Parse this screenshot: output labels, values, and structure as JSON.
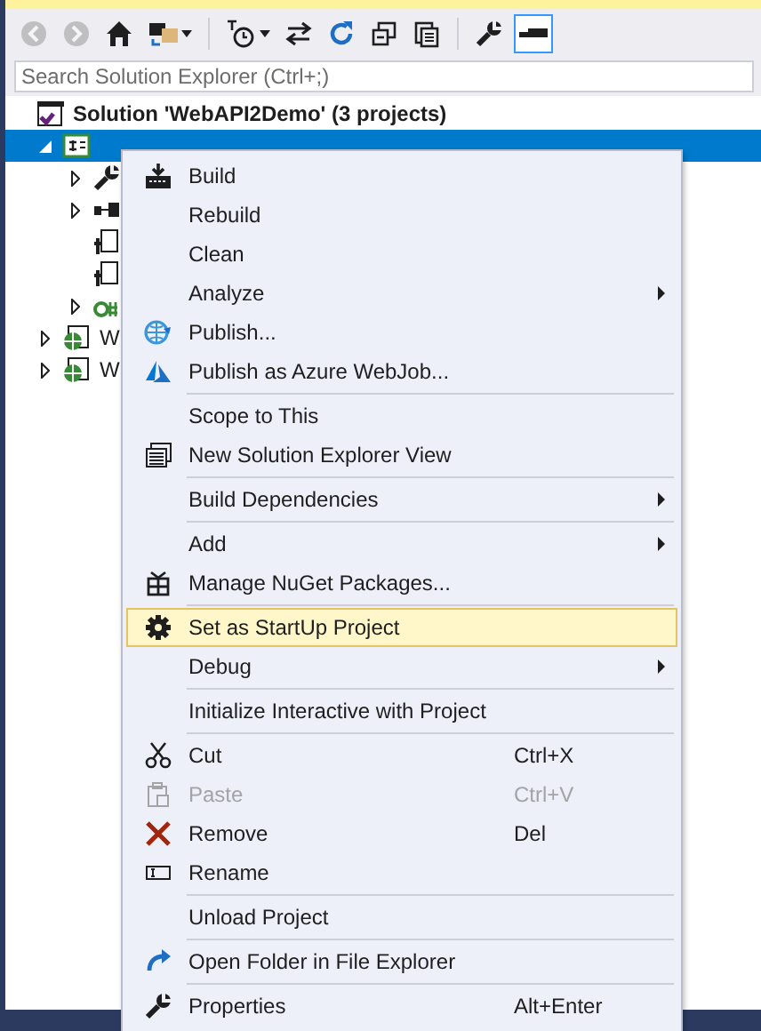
{
  "toolbar": [
    {
      "kind": "button",
      "disabled": true
    },
    {
      "kind": "button",
      "disabled": true
    },
    {
      "kind": "button",
      "disabled": false
    },
    {
      "kind": "dropdown",
      "disabled": false
    },
    {
      "kind": "separator"
    },
    {
      "kind": "dropdown",
      "disabled": false
    },
    {
      "kind": "button",
      "disabled": false
    },
    {
      "kind": "button",
      "disabled": false
    },
    {
      "kind": "button",
      "disabled": false
    },
    {
      "kind": "button",
      "disabled": false
    },
    {
      "kind": "separator"
    },
    {
      "kind": "button",
      "disabled": false
    },
    {
      "kind": "toggle",
      "on": true
    }
  ],
  "search": {
    "placeholder": "Search Solution Explorer (Ctrl+;)"
  },
  "tree": [
    {
      "kind": "solution",
      "label": "Solution 'WebAPI2Demo' (3 projects)",
      "selected": false,
      "children": [
        {
          "kind": "project",
          "selected": true,
          "expanded": true,
          "children": [
            {
              "kind": "properties",
              "selected": false,
              "expanded": false
            },
            {
              "kind": "references",
              "selected": false,
              "expanded": false
            },
            {
              "kind": "config_file",
              "selected": false
            },
            {
              "kind": "config_file",
              "selected": false
            },
            {
              "kind": "code_file",
              "selected": false,
              "expanded": false
            }
          ]
        },
        {
          "kind": "web_project",
          "label": "W",
          "selected": false,
          "expanded": false
        },
        {
          "kind": "web_project",
          "label": "W",
          "selected": false,
          "expanded": false
        }
      ]
    }
  ],
  "context_menu": [
    {
      "kind": "item",
      "label": "Build",
      "selected": false,
      "disabled": false,
      "submenu": false
    },
    {
      "kind": "item",
      "label": "Rebuild",
      "selected": false,
      "disabled": false,
      "submenu": false
    },
    {
      "kind": "item",
      "label": "Clean",
      "selected": false,
      "disabled": false,
      "submenu": false
    },
    {
      "kind": "item",
      "label": "Analyze",
      "selected": false,
      "disabled": false,
      "submenu": true
    },
    {
      "kind": "item",
      "label": "Publish...",
      "selected": false,
      "disabled": false,
      "submenu": false
    },
    {
      "kind": "item",
      "label": "Publish as Azure WebJob...",
      "selected": false,
      "disabled": false,
      "submenu": false
    },
    {
      "kind": "separator"
    },
    {
      "kind": "item",
      "label": "Scope to This",
      "selected": false,
      "disabled": false,
      "submenu": false
    },
    {
      "kind": "item",
      "label": "New Solution Explorer View",
      "selected": false,
      "disabled": false,
      "submenu": false
    },
    {
      "kind": "separator"
    },
    {
      "kind": "item",
      "label": "Build Dependencies",
      "selected": false,
      "disabled": false,
      "submenu": true
    },
    {
      "kind": "separator"
    },
    {
      "kind": "item",
      "label": "Add",
      "selected": false,
      "disabled": false,
      "submenu": true
    },
    {
      "kind": "item",
      "label": "Manage NuGet Packages...",
      "selected": false,
      "disabled": false,
      "submenu": false
    },
    {
      "kind": "separator"
    },
    {
      "kind": "item",
      "label": "Set as StartUp Project",
      "selected": true,
      "disabled": false,
      "submenu": false
    },
    {
      "kind": "item",
      "label": "Debug",
      "selected": false,
      "disabled": false,
      "submenu": true
    },
    {
      "kind": "separator"
    },
    {
      "kind": "item",
      "label": "Initialize Interactive with Project",
      "selected": false,
      "disabled": false,
      "submenu": false
    },
    {
      "kind": "separator"
    },
    {
      "kind": "item",
      "label": "Cut",
      "shortcut": "Ctrl+X",
      "selected": false,
      "disabled": false,
      "submenu": false
    },
    {
      "kind": "item",
      "label": "Paste",
      "shortcut": "Ctrl+V",
      "selected": false,
      "disabled": true,
      "submenu": false
    },
    {
      "kind": "item",
      "label": "Remove",
      "shortcut": "Del",
      "selected": false,
      "disabled": false,
      "submenu": false
    },
    {
      "kind": "item",
      "label": "Rename",
      "selected": false,
      "disabled": false,
      "submenu": false
    },
    {
      "kind": "separator"
    },
    {
      "kind": "item",
      "label": "Unload Project",
      "selected": false,
      "disabled": false,
      "submenu": false
    },
    {
      "kind": "separator"
    },
    {
      "kind": "item",
      "label": "Open Folder in File Explorer",
      "selected": false,
      "disabled": false,
      "submenu": false
    },
    {
      "kind": "separator"
    },
    {
      "kind": "item",
      "label": "Properties",
      "shortcut": "Alt+Enter",
      "selected": false,
      "disabled": false,
      "submenu": false
    }
  ]
}
